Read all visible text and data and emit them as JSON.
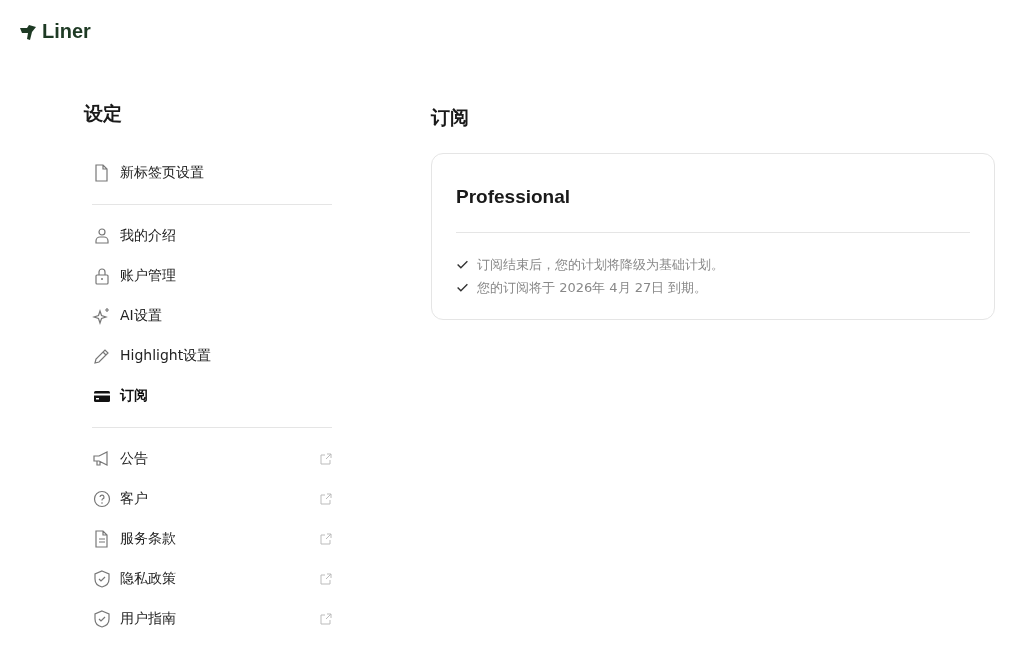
{
  "logo": {
    "text": "Liner"
  },
  "sidebar": {
    "title": "设定",
    "groups": [
      {
        "items": [
          {
            "label": "新标签页设置",
            "selected": false,
            "external": false
          }
        ]
      },
      {
        "items": [
          {
            "label": "我的介绍",
            "selected": false,
            "external": false
          },
          {
            "label": "账户管理",
            "selected": false,
            "external": false
          },
          {
            "label": "AI设置",
            "selected": false,
            "external": false
          },
          {
            "label": "Highlight设置",
            "selected": false,
            "external": false
          },
          {
            "label": "订阅",
            "selected": true,
            "external": false
          }
        ]
      },
      {
        "items": [
          {
            "label": "公告",
            "selected": false,
            "external": true
          },
          {
            "label": "客户",
            "selected": false,
            "external": true
          },
          {
            "label": "服务条款",
            "selected": false,
            "external": true
          },
          {
            "label": "隐私政策",
            "selected": false,
            "external": true
          },
          {
            "label": "用户指南",
            "selected": false,
            "external": true
          }
        ]
      }
    ]
  },
  "main": {
    "title": "订阅",
    "plan": {
      "name": "Professional",
      "notes": [
        "订阅结束后，您的计划将降级为基础计划。",
        "您的订阅将于 2026年 4月 27日 到期。"
      ]
    }
  }
}
